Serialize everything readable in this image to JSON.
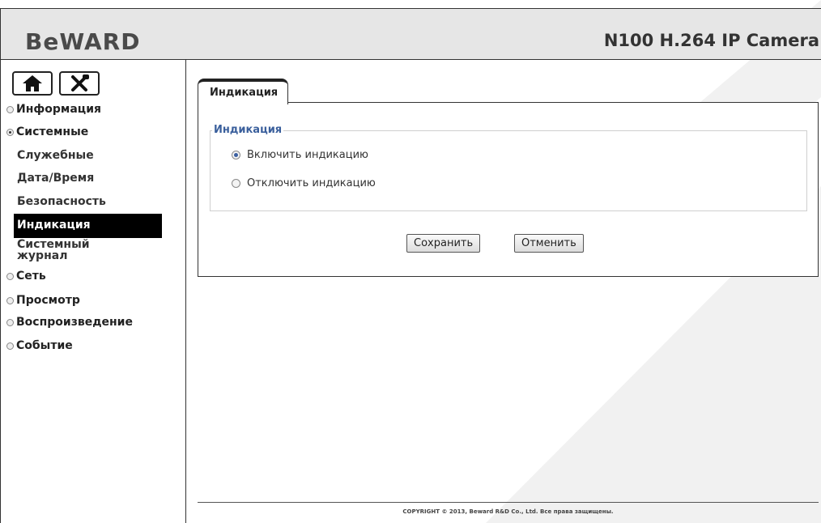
{
  "header": {
    "logo": "BeWARD",
    "model": "N100 H.264 IP Camera"
  },
  "sidebar": {
    "buttons": [
      {
        "icon": "home-icon"
      },
      {
        "icon": "tools-icon"
      }
    ],
    "items": [
      {
        "label": "Информация"
      },
      {
        "label": "Системные"
      },
      {
        "label": "Сеть"
      },
      {
        "label": "Просмотр"
      },
      {
        "label": "Воспроизведение"
      },
      {
        "label": "Событие"
      }
    ],
    "subitems": [
      {
        "label": "Служебные"
      },
      {
        "label": "Дата/Время"
      },
      {
        "label": "Безопасность"
      },
      {
        "label": "Индикация"
      },
      {
        "label": "Системный журнал"
      }
    ]
  },
  "main": {
    "tab": "Индикация",
    "section": "Индикация",
    "options": [
      {
        "label": "Включить индикацию",
        "selected": true
      },
      {
        "label": "Отключить индикацию",
        "selected": false
      }
    ],
    "save": "Сохранить",
    "cancel": "Отменить"
  },
  "footer": "COPYRIGHT © 2013, Beward R&D Co., Ltd. Все права защищены."
}
